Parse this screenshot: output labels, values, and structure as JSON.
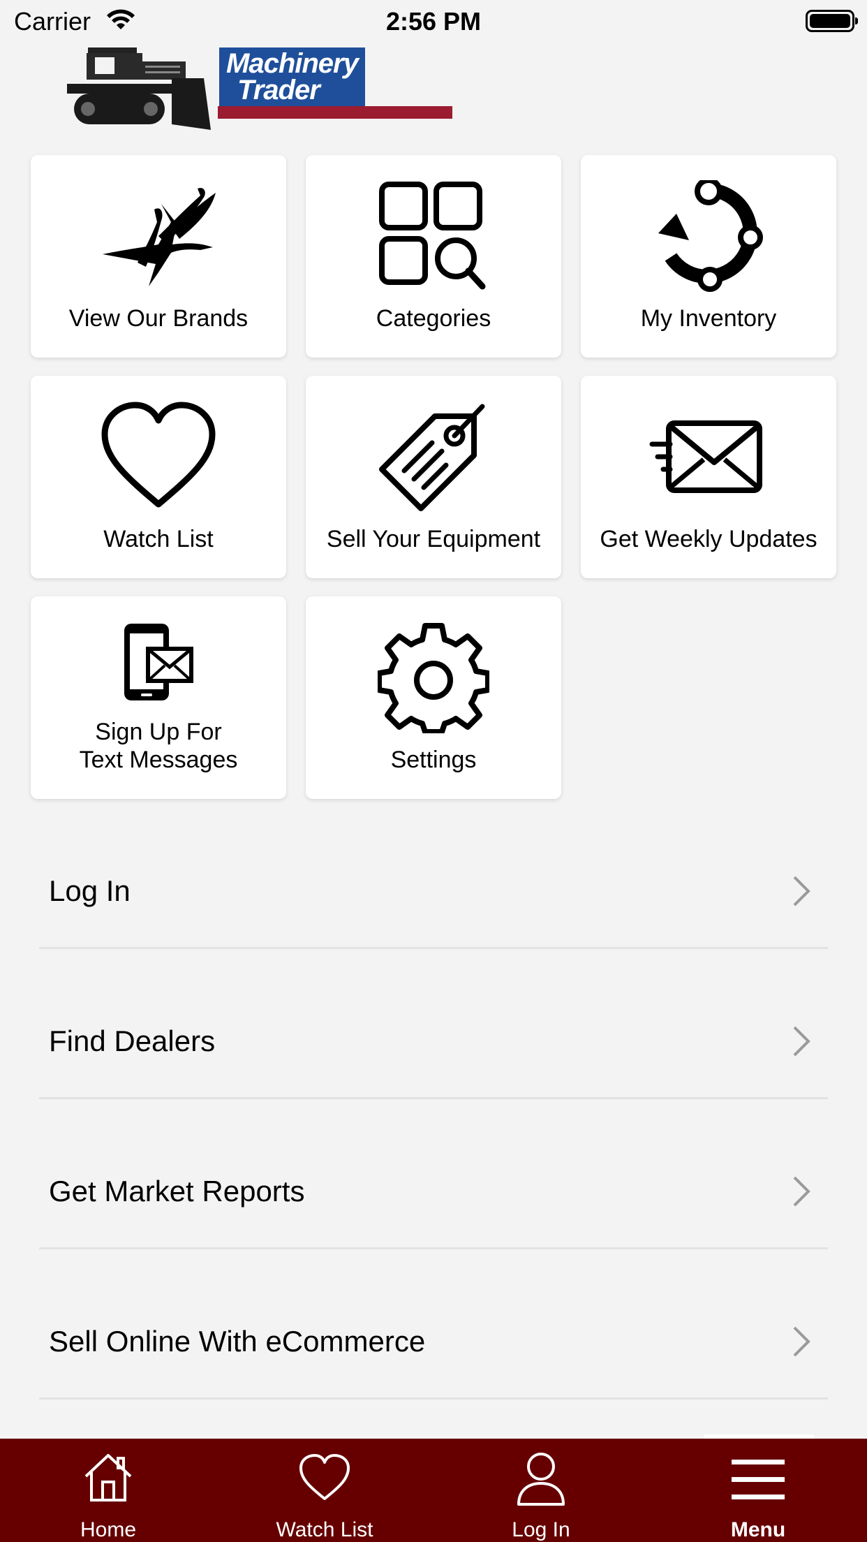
{
  "status_bar": {
    "carrier": "Carrier",
    "time": "2:56 PM"
  },
  "logo": {
    "line1": "Machinery",
    "line2": "Trader"
  },
  "colors": {
    "brand_maroon": "#660000",
    "background": "#f3f3f3",
    "tile": "#ffffff"
  },
  "tiles": [
    {
      "label": "View Our Brands",
      "icon": "cranes-icon"
    },
    {
      "label": "Categories",
      "icon": "categories-search-icon"
    },
    {
      "label": "My Inventory",
      "icon": "inventory-cycle-icon"
    },
    {
      "label": "Watch List",
      "icon": "heart-icon"
    },
    {
      "label": "Sell Your Equipment",
      "icon": "price-tag-icon"
    },
    {
      "label": "Get Weekly Updates",
      "icon": "fast-mail-icon"
    },
    {
      "label": "Sign Up For\nText Messages",
      "icon": "phone-mail-icon"
    },
    {
      "label": "Settings",
      "icon": "gear-icon"
    }
  ],
  "menu_list": [
    {
      "label": "Log In"
    },
    {
      "label": "Find Dealers"
    },
    {
      "label": "Get Market Reports"
    },
    {
      "label": "Sell Online With eCommerce"
    }
  ],
  "tab_bar": [
    {
      "label": "Home",
      "icon": "home-icon"
    },
    {
      "label": "Watch List",
      "icon": "heart-icon"
    },
    {
      "label": "Log In",
      "icon": "user-icon"
    },
    {
      "label": "Menu",
      "icon": "menu-icon",
      "active": true
    }
  ]
}
